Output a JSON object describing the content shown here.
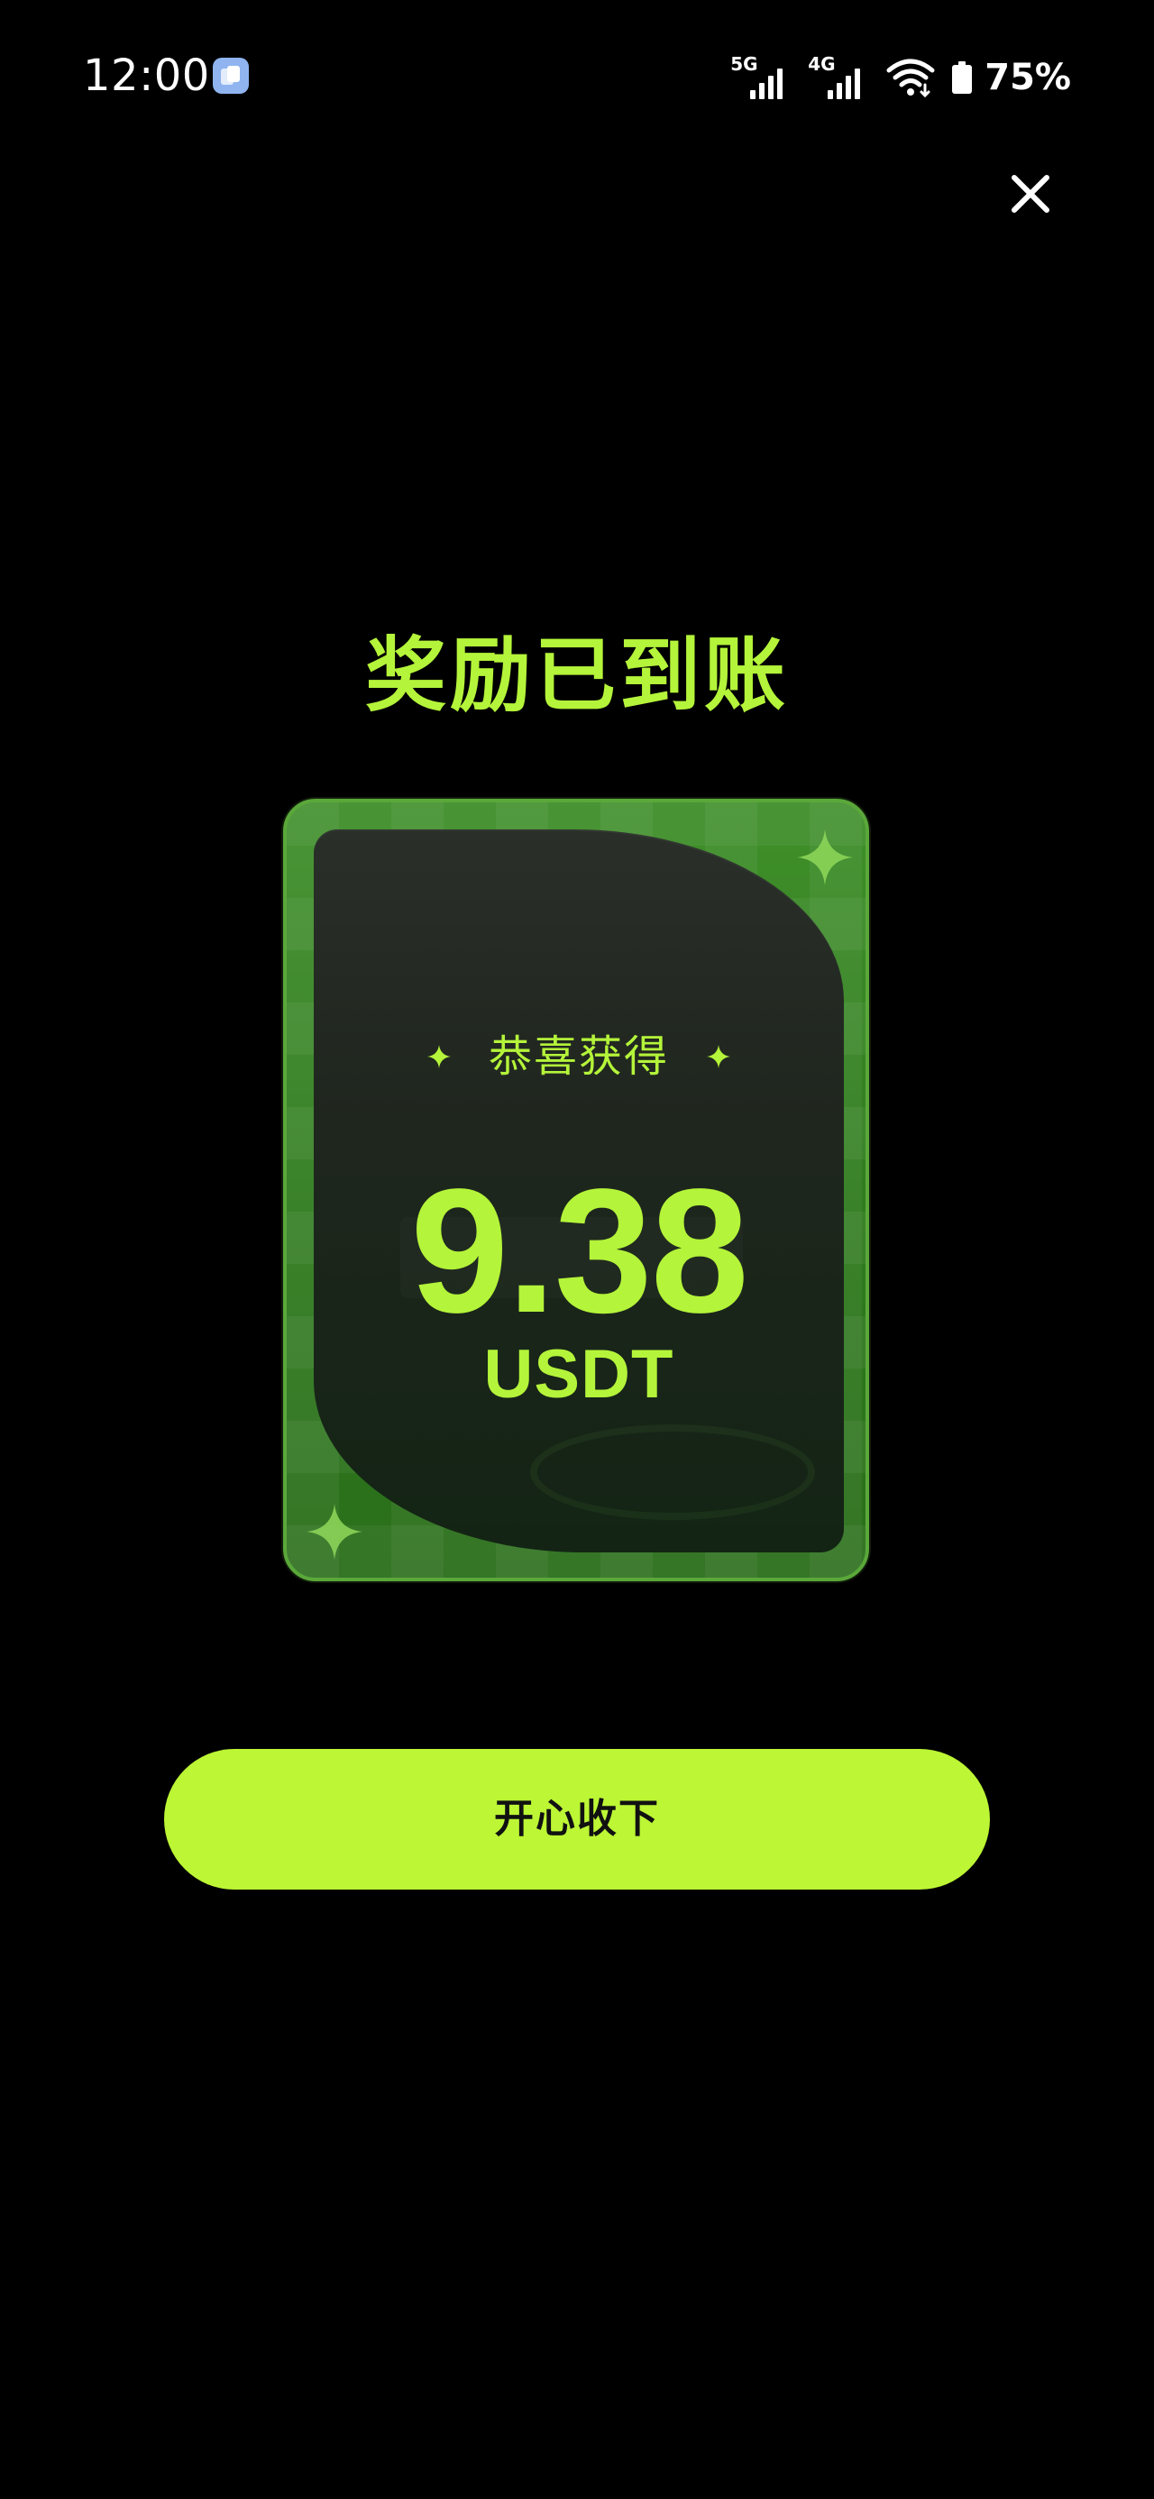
{
  "status_bar": {
    "time": "12:00",
    "network_1": "5G",
    "network_2": "4G",
    "battery": "75%",
    "icons": [
      "app-notification-icon",
      "signal-icon",
      "signal-icon",
      "wifi-icon",
      "battery-icon"
    ]
  },
  "dialog": {
    "close_icon": "close-icon",
    "title": "奖励已到账",
    "card": {
      "congrats": "恭喜获得",
      "amount": "9.38",
      "unit": "USDT"
    },
    "accept_label": "开心收下"
  },
  "colors": {
    "background": "#000000",
    "accent": "#b4f43a",
    "button": "#bcf635",
    "card_border": "#5aa83a",
    "card_green": "#3f8f2a",
    "card_inner": "#1f261e"
  }
}
